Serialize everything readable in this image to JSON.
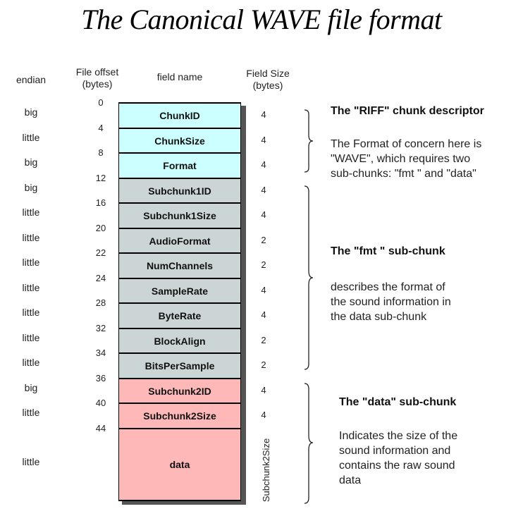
{
  "title": "The Canonical WAVE file format",
  "headers": {
    "endian": "endian",
    "offset_line1": "File offset",
    "offset_line2": "(bytes)",
    "field_name": "field name",
    "size_line1": "Field Size",
    "size_line2": "(bytes)"
  },
  "offsets": [
    "0",
    "4",
    "8",
    "12",
    "16",
    "20",
    "22",
    "24",
    "28",
    "32",
    "34",
    "36",
    "40",
    "44"
  ],
  "fields": [
    {
      "name": "ChunkID",
      "endian": "big",
      "size": "4",
      "chunk": "riff"
    },
    {
      "name": "ChunkSize",
      "endian": "little",
      "size": "4",
      "chunk": "riff"
    },
    {
      "name": "Format",
      "endian": "big",
      "size": "4",
      "chunk": "riff"
    },
    {
      "name": "Subchunk1ID",
      "endian": "big",
      "size": "4",
      "chunk": "fmt"
    },
    {
      "name": "Subchunk1Size",
      "endian": "little",
      "size": "4",
      "chunk": "fmt"
    },
    {
      "name": "AudioFormat",
      "endian": "little",
      "size": "2",
      "chunk": "fmt"
    },
    {
      "name": "NumChannels",
      "endian": "little",
      "size": "2",
      "chunk": "fmt"
    },
    {
      "name": "SampleRate",
      "endian": "little",
      "size": "4",
      "chunk": "fmt"
    },
    {
      "name": "ByteRate",
      "endian": "little",
      "size": "4",
      "chunk": "fmt"
    },
    {
      "name": "BlockAlign",
      "endian": "little",
      "size": "2",
      "chunk": "fmt"
    },
    {
      "name": "BitsPerSample",
      "endian": "little",
      "size": "2",
      "chunk": "fmt"
    },
    {
      "name": "Subchunk2ID",
      "endian": "big",
      "size": "4",
      "chunk": "data"
    },
    {
      "name": "Subchunk2Size",
      "endian": "little",
      "size": "4",
      "chunk": "data"
    },
    {
      "name": "data",
      "endian": "little",
      "size": "Subchunk2Size",
      "chunk": "data"
    }
  ],
  "colors": {
    "riff": "#ccffff",
    "fmt": "#ccd5d5",
    "data": "#ffb8b8"
  },
  "annotations": {
    "riff": {
      "title": "The \"RIFF\" chunk descriptor",
      "body": [
        "The Format of concern here is",
        "\"WAVE\", which requires two",
        "sub-chunks: \"fmt \" and \"data\""
      ]
    },
    "fmt": {
      "title": "The \"fmt \" sub-chunk",
      "body": [
        "describes the format of",
        "the sound information in",
        "the data sub-chunk"
      ]
    },
    "data": {
      "title": "The \"data\" sub-chunk",
      "body": [
        "Indicates the size of the",
        "sound information and",
        "contains the raw sound",
        "data"
      ]
    }
  }
}
